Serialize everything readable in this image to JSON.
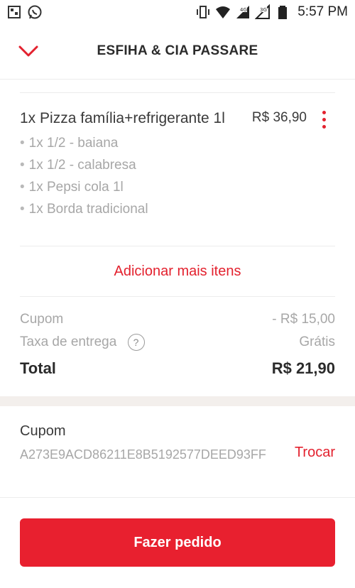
{
  "statusbar": {
    "time": "5:57 PM",
    "icons": [
      "notification-icon",
      "whatsapp-icon",
      "vibrate-icon",
      "wifi-icon",
      "signal-4g-icon",
      "signal-3g-icon",
      "battery-icon"
    ],
    "badge_4g": "4G",
    "badge_3g": "3G"
  },
  "header": {
    "title": "ESFIHA & CIA PASSARE",
    "accent": "#e3212e"
  },
  "item": {
    "qty": "1x",
    "name": "Pizza família+refrigerante 1l",
    "price": "R$ 36,90",
    "options": [
      "1x 1/2 - baiana",
      "1x 1/2 - calabresa",
      "1x Pepsi cola 1l",
      "1x Borda tradicional"
    ]
  },
  "add_more_label": "Adicionar mais itens",
  "summary": {
    "coupon_label": "Cupom",
    "coupon_value": "- R$ 15,00",
    "delivery_label": "Taxa de entrega",
    "delivery_help": "?",
    "delivery_value": "Grátis",
    "total_label": "Total",
    "total_value": "R$ 21,90"
  },
  "coupon": {
    "title": "Cupom",
    "code": "A273E9ACD86211E8B5192577DEED93FF",
    "swap_label": "Trocar"
  },
  "cta": {
    "label": "Fazer pedido",
    "color": "#e8202f"
  }
}
